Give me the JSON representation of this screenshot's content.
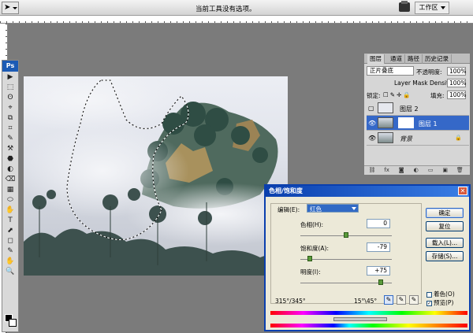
{
  "options_bar": {
    "status_text": "当前工具没有选项。",
    "workspace_label": "工作区"
  },
  "toolbox": {
    "logo": "Ps",
    "tools": [
      "▶",
      "⬚",
      "ʘ",
      "⌖",
      "⧉",
      "⌗",
      "✎",
      "⚒",
      "⬣",
      "◐",
      "⌫",
      "▦",
      "⬭",
      "✋",
      "T",
      "⬈",
      "◻",
      "✎",
      "✋",
      "🔍"
    ]
  },
  "layers_panel": {
    "tabs": [
      "图层",
      "通道",
      "路径",
      "历史记录"
    ],
    "blend_mode": "正片叠底",
    "opacity_label": "不透明度:",
    "opacity_value": "100%",
    "mask_density_label": "Layer Mask Density",
    "mask_density_value": "100%",
    "lock_label": "锁定:",
    "fill_label": "填充:",
    "fill_value": "100%",
    "layers": [
      {
        "name": "图层 2",
        "visible": false,
        "selected": false
      },
      {
        "name": "图层 1",
        "visible": true,
        "selected": true
      },
      {
        "name": "背景",
        "visible": true,
        "selected": false
      }
    ]
  },
  "dialog": {
    "title": "色相/饱和度",
    "edit_label": "编辑(E):",
    "edit_value": "红色",
    "hue_label": "色相(H):",
    "hue_value": "0",
    "saturation_label": "饱和度(A):",
    "saturation_value": "-79",
    "lightness_label": "明度(I):",
    "lightness_value": "+75",
    "ok_label": "确定",
    "reset_label": "复位",
    "load_label": "载入(L)...",
    "save_label": "存储(S)...",
    "colorize_label": "着色(O)",
    "colorize_checked": false,
    "preview_label": "预览(P)",
    "preview_checked": true,
    "range_left": "315°/345°",
    "range_right": "15°\\45°",
    "hue_slider": 0.5,
    "saturation_slider": 0.105,
    "lightness_slider": 0.875
  },
  "colors": {
    "accent": "#316ac5",
    "titlebar": "#0a3fae"
  }
}
